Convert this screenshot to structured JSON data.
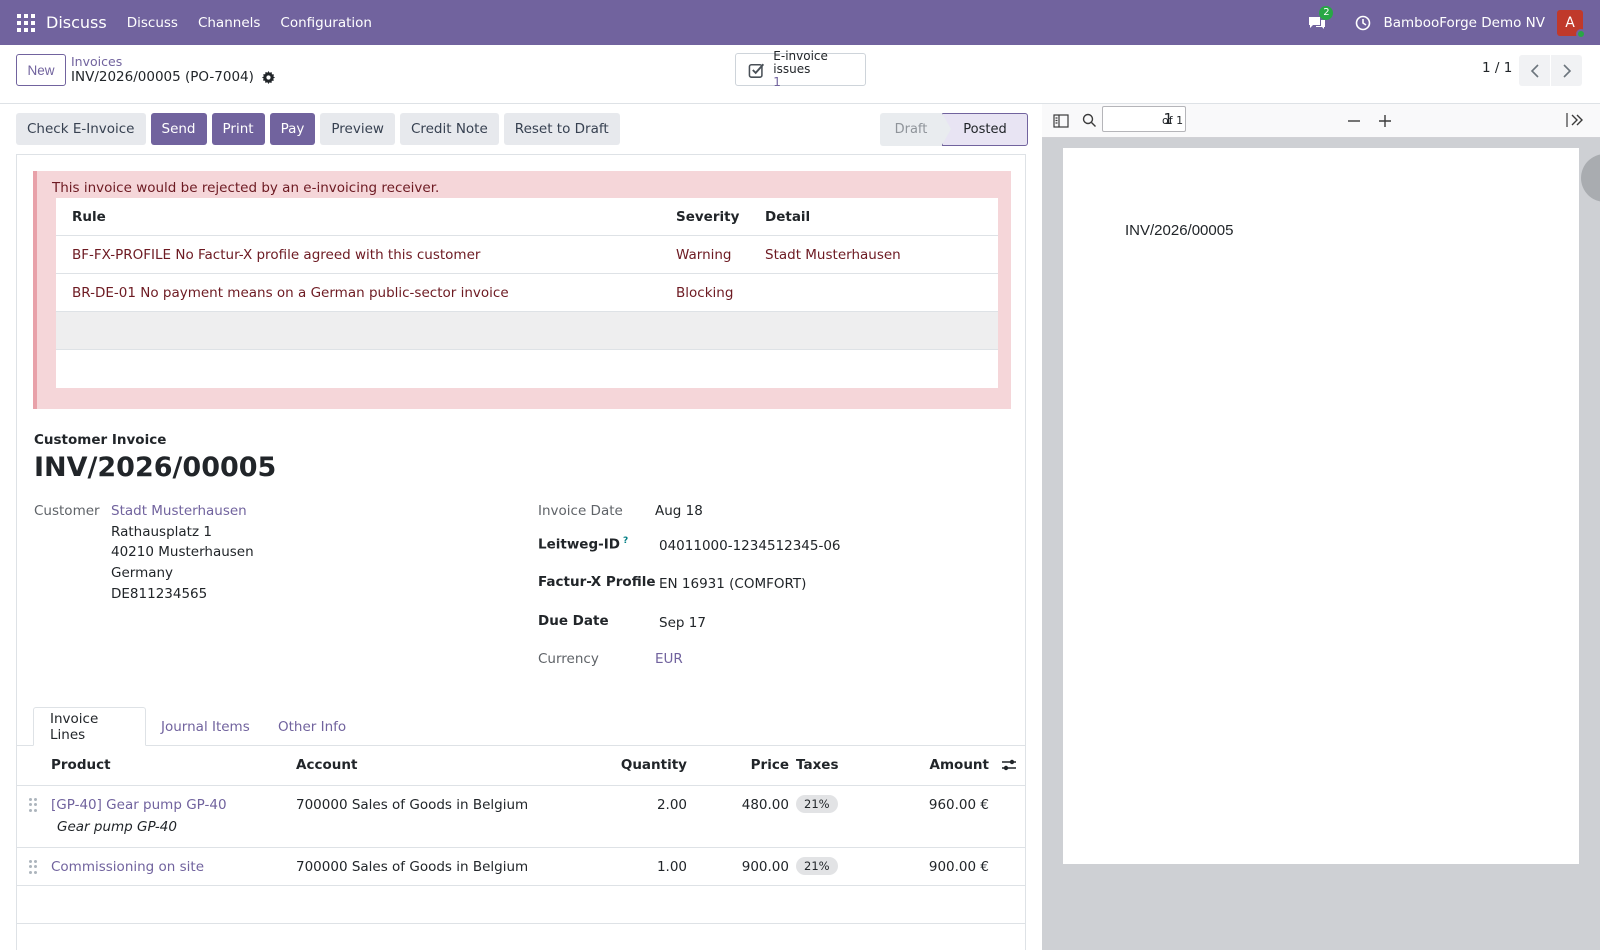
{
  "navbar": {
    "brand": "Discuss",
    "menus": [
      "Discuss",
      "Channels",
      "Configuration"
    ],
    "chat_count": "2",
    "company": "BambooForge Demo NV",
    "avatar_letter": "A"
  },
  "control_panel": {
    "new_label": "New",
    "breadcrumb_parent": "Invoices",
    "breadcrumb_current": "INV/2026/00005 (PO-7004)",
    "einvoice_label": "E-invoice issues",
    "einvoice_count": "1",
    "pager": "1 / 1"
  },
  "actions": [
    "Check E-Invoice",
    "Send",
    "Print",
    "Pay",
    "Preview",
    "Credit Note",
    "Reset to Draft"
  ],
  "status": {
    "draft": "Draft",
    "posted": "Posted"
  },
  "alert": {
    "title": "This invoice would be rejected by an e-invoicing receiver.",
    "headers": {
      "rule": "Rule",
      "severity": "Severity",
      "detail": "Detail"
    },
    "rows": [
      {
        "rule": "BF-FX-PROFILE No Factur-X profile agreed with this customer",
        "severity": "Warning",
        "detail": "Stadt Musterhausen"
      },
      {
        "rule": "BR-DE-01 No payment means on a German public-sector invoice",
        "severity": "Blocking",
        "detail": ""
      }
    ]
  },
  "invoice": {
    "type": "Customer Invoice",
    "name": "INV/2026/00005",
    "customer_label": "Customer",
    "customer_name": "Stadt Musterhausen",
    "address": [
      "Rathausplatz 1",
      "40210 Musterhausen",
      "Germany",
      "DE811234565"
    ],
    "invoice_date_label": "Invoice Date",
    "invoice_date": "Aug 18",
    "leitweg_label": "Leitweg-ID",
    "leitweg_help": "?",
    "leitweg": "04011000-1234512345-06",
    "facturx_label": "Factur-X Profile",
    "facturx": "EN 16931 (COMFORT)",
    "due_label": "Due Date",
    "due": "Sep 17",
    "currency_label": "Currency",
    "currency": "EUR"
  },
  "tabs": [
    "Invoice Lines",
    "Journal Items",
    "Other Info"
  ],
  "lines": {
    "headers": {
      "product": "Product",
      "account": "Account",
      "quantity": "Quantity",
      "price": "Price",
      "taxes": "Taxes",
      "amount": "Amount"
    },
    "rows": [
      {
        "product": "[GP-40] Gear pump GP-40",
        "description": "Gear pump GP-40",
        "account": "700000 Sales of Goods in Belgium",
        "quantity": "2.00",
        "price": "480.00",
        "tax": "21%",
        "amount": "960.00 €"
      },
      {
        "product": "Commissioning on site",
        "description": "",
        "account": "700000 Sales of Goods in Belgium",
        "quantity": "1.00",
        "price": "900.00",
        "tax": "21%",
        "amount": "900.00 €"
      }
    ]
  },
  "pdf": {
    "page_input": "1",
    "page_of": "of 1",
    "content_text": "INV/2026/00005"
  },
  "colors": {
    "brand": "#71639e",
    "alert_bg": "#f5d6d9",
    "alert_text": "#6d1a22"
  }
}
